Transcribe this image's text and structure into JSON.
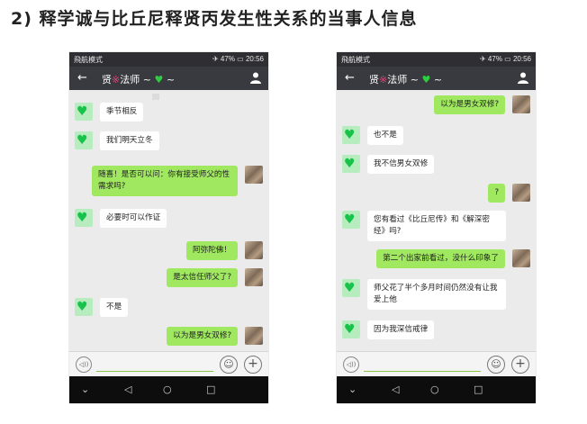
{
  "heading": "2) 释学诚与比丘尼释贤丙发生性关系的当事人信息",
  "status": {
    "left": "飛航模式",
    "battery": "47%",
    "time": "20:56"
  },
  "chat_title": {
    "name": "贤",
    "suffix": "法师 ~",
    "tail": "~"
  },
  "left_phone": {
    "messages": [
      {
        "side": "other",
        "text": "季节相反"
      },
      {
        "side": "other",
        "text": "我们明天立冬"
      },
      {
        "side": "me",
        "text": "随喜！是否可以问：你有接受师父的性需求吗?"
      },
      {
        "side": "other",
        "text": "必要时可以作证"
      },
      {
        "side": "me",
        "text": "阿弥陀佛！"
      },
      {
        "side": "me",
        "text": "是太信任师父了?"
      },
      {
        "side": "other",
        "text": "不是"
      },
      {
        "side": "me",
        "text": "以为是男女双修?"
      }
    ]
  },
  "right_phone": {
    "messages": [
      {
        "side": "me",
        "text": "以为是男女双修?"
      },
      {
        "side": "other",
        "text": "也不是"
      },
      {
        "side": "other",
        "text": "我不信男女双修"
      },
      {
        "side": "me",
        "text": "?"
      },
      {
        "side": "other",
        "text": "您有看过《比丘尼传》和《解深密经》吗?"
      },
      {
        "side": "me",
        "text": "第二个出家前看过，没什么印象了"
      },
      {
        "side": "other",
        "text": "师父花了半个多月时间仍然没有让我爱上他"
      },
      {
        "side": "other",
        "text": "因为我深信戒律"
      }
    ]
  },
  "icons": {
    "back": "arrow-left-icon",
    "contact": "person-icon",
    "voice": "voice-icon",
    "emoji": "emoji-icon",
    "plus": "plus-icon",
    "heart": "green-heart-icon"
  },
  "colors": {
    "my_bubble": "#9fe85f",
    "other_bubble": "#ffffff",
    "title_bar": "#393a3f",
    "chat_bg": "#ebebeb"
  }
}
